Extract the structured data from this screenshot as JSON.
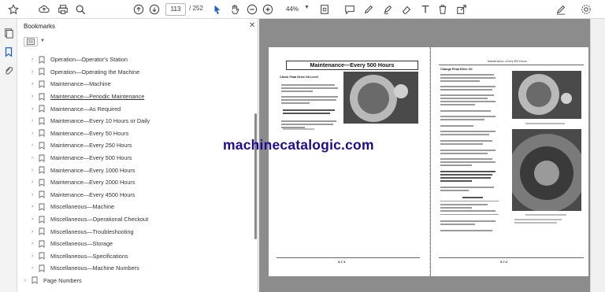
{
  "toolbar": {
    "current_page": "113",
    "total_pages": "/ 252",
    "zoom": "44%",
    "icons": [
      "star-icon",
      "cloud-upload-icon",
      "print-icon",
      "search-icon",
      "page-up-icon",
      "page-down-icon",
      "select-cursor-icon",
      "hand-icon",
      "zoom-out-icon",
      "zoom-in-icon",
      "fit-page-icon",
      "comment-icon",
      "pen-icon",
      "highlighter-icon",
      "eraser-icon",
      "text-icon",
      "delete-icon",
      "share-icon",
      "edit-pdf-icon",
      "settings-icon"
    ]
  },
  "panel": {
    "title": "Bookmarks",
    "items": [
      {
        "label": "Operation—Operator's Station",
        "level": 1
      },
      {
        "label": "Operation—Operating the Machine",
        "level": 1
      },
      {
        "label": "Maintenance—Machine",
        "level": 1
      },
      {
        "label": "Maintenance—Periodic Maintenance",
        "level": 1
      },
      {
        "label": "Maintenance—As Required",
        "level": 1
      },
      {
        "label": "Maintenance—Every 10 Hours or Daily",
        "level": 1
      },
      {
        "label": "Maintenance—Every 50 Hours",
        "level": 1
      },
      {
        "label": "Maintenance—Every 250 Hours",
        "level": 1
      },
      {
        "label": "Maintenance—Every 500 Hours",
        "level": 1
      },
      {
        "label": "Maintenance—Every 1000 Hours",
        "level": 1
      },
      {
        "label": "Maintenance—Every 2000 Hours",
        "level": 1
      },
      {
        "label": "Maintenance—Every 4500 Hours",
        "level": 1
      },
      {
        "label": "Miscellaneous—Machine",
        "level": 1
      },
      {
        "label": "Miscellaneous—Operational Checkout",
        "level": 1
      },
      {
        "label": "Miscellaneous—Troubleshooting",
        "level": 1
      },
      {
        "label": "Miscellaneous—Storage",
        "level": 1
      },
      {
        "label": "Miscellaneous—Specifications",
        "level": 1
      },
      {
        "label": "Miscellaneous—Machine Numbers",
        "level": 1
      },
      {
        "label": "Page Numbers",
        "level": 0
      }
    ]
  },
  "document": {
    "left_page": {
      "title": "Maintenance—Every 500 Hours",
      "subhead": "Check Final Drive Oil Level",
      "page_number": "3-7-1"
    },
    "right_page": {
      "header": "Maintenance—Every 500 Hours",
      "subhead": "Change Final Drive Oil",
      "page_number": "3-7-2"
    },
    "watermark": "machinecatalogic.com"
  }
}
